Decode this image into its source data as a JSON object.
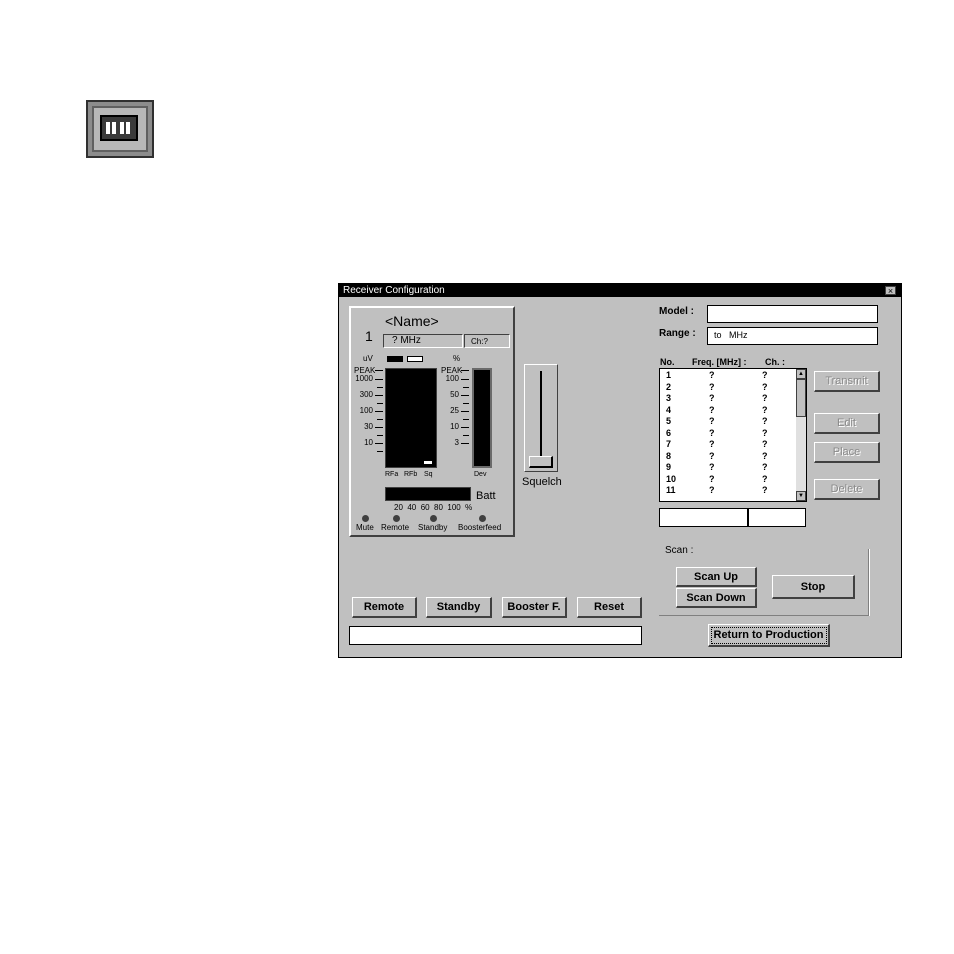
{
  "window": {
    "title": "Receiver Configuration",
    "close_glyph": "×"
  },
  "receiver": {
    "number": "1",
    "name": "<Name>",
    "freq": "? MHz",
    "channel": "Ch:?",
    "uv_label": "uV",
    "pct_label": "%",
    "peak_left": "PEAK",
    "peak_right": "PEAK",
    "scale_left": [
      "1000",
      "300",
      "100",
      "30",
      "10"
    ],
    "scale_right": [
      "100",
      "50",
      "25",
      "10",
      "3"
    ],
    "bar_labels": {
      "rfa": "RFa",
      "rfb": "RFb",
      "sq": "Sq",
      "dev": "Dev"
    },
    "batt_label": "Batt",
    "batt_scale": "20  40  60  80  100  %",
    "leds": [
      "Mute",
      "Remote",
      "Standby",
      "Boosterfeed"
    ]
  },
  "squelch": {
    "label": "Squelch"
  },
  "model": {
    "label": "Model :",
    "value": ""
  },
  "range": {
    "label": "Range :",
    "value": "to   MHz"
  },
  "preset_table": {
    "headers": [
      "No.",
      "Freq. [MHz] :",
      "Ch. :"
    ],
    "rows": [
      [
        "1",
        "?",
        "?"
      ],
      [
        "2",
        "?",
        "?"
      ],
      [
        "3",
        "?",
        "?"
      ],
      [
        "4",
        "?",
        "?"
      ],
      [
        "5",
        "?",
        "?"
      ],
      [
        "6",
        "?",
        "?"
      ],
      [
        "7",
        "?",
        "?"
      ],
      [
        "8",
        "?",
        "?"
      ],
      [
        "9",
        "?",
        "?"
      ],
      [
        "10",
        "?",
        "?"
      ],
      [
        "11",
        "?",
        "?"
      ]
    ]
  },
  "side_buttons": {
    "transmit": "Transmit",
    "edit": "Edit",
    "place": "Place",
    "delete": "Delete"
  },
  "scan": {
    "label": "Scan :",
    "up": "Scan Up",
    "down": "Scan Down",
    "stop": "Stop"
  },
  "bottom_buttons": {
    "remote": "Remote",
    "standby": "Standby",
    "booster": "Booster F.",
    "reset": "Reset"
  },
  "status_text": "",
  "return_button": "Return to Production",
  "icons": {
    "app_icon": "receiver-pair-icon"
  },
  "colors": {
    "titlebar": "#000000",
    "panel": "#c0c0c0"
  }
}
